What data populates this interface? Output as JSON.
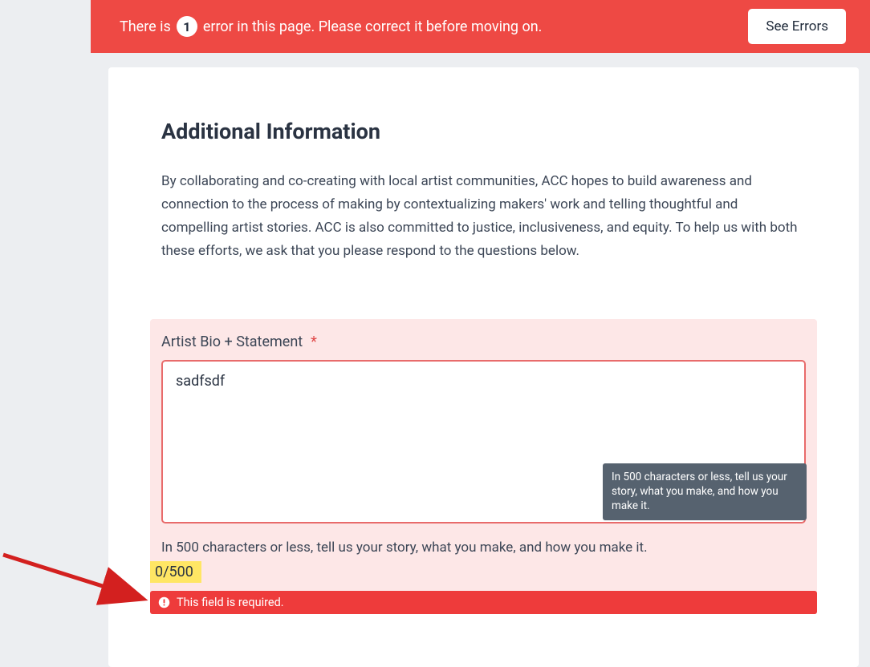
{
  "banner": {
    "prefix": "There is",
    "count": "1",
    "suffix": "error in this page. Please correct it before moving on.",
    "see_errors_label": "See Errors"
  },
  "section": {
    "title": "Additional Information",
    "description": "By collaborating and co-creating with local artist communities, ACC hopes to build awareness and connection to the process of making by contextualizing makers' work and telling thoughtful and compelling artist stories. ACC is also committed to justice, inclusiveness, and equity. To help us with both these efforts, we ask that you please respond to the questions below."
  },
  "field": {
    "label": "Artist Bio + Statement",
    "required_marker": "*",
    "value": "sadfsdf",
    "tooltip": "In 500 characters or less, tell us your story, what you make, and how you make it.",
    "helper": "In 500 characters or less, tell us your story, what you make, and how you make it.",
    "counter": "0/500",
    "error_message": "This field is required."
  }
}
